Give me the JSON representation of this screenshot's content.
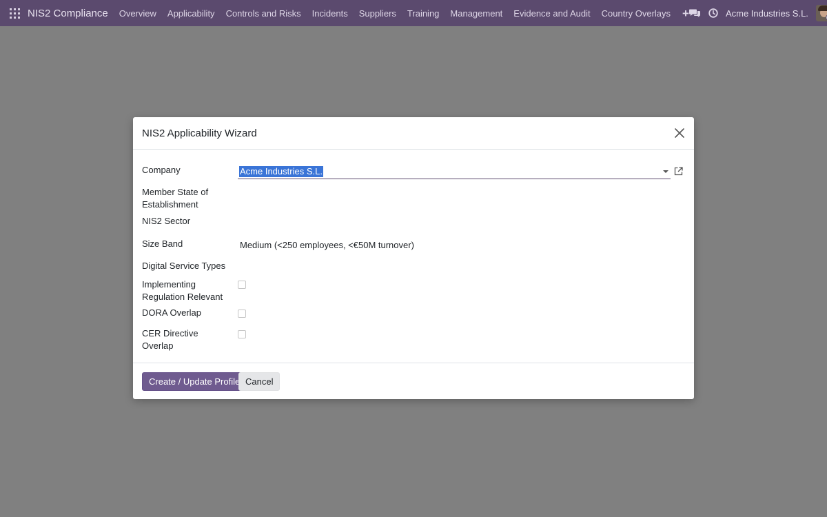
{
  "navbar": {
    "brand": "NIS2 Compliance",
    "menu": [
      "Overview",
      "Applicability",
      "Controls and Risks",
      "Incidents",
      "Suppliers",
      "Training",
      "Management",
      "Evidence and Audit",
      "Country Overlays"
    ],
    "plus_icon": "+",
    "icons": [
      "apps-grid-icon",
      "chat-icon",
      "clock-icon"
    ],
    "company": "Acme Industries S.L.",
    "colors": {
      "navbar_bg": "#5b4a6e",
      "primary": "#6f5b8f",
      "backdrop": "#808080"
    }
  },
  "dialog": {
    "title": "NIS2 Applicability Wizard",
    "fields": {
      "company": {
        "label": "Company",
        "value": "Acme Industries S.L."
      },
      "member_state": {
        "label": "Member State of Establishment"
      },
      "sector": {
        "label": "NIS2 Sector"
      },
      "size_band": {
        "label": "Size Band",
        "value": "Medium (<250 employees, <€50M turnover)"
      },
      "digital_service_types": {
        "label": "Digital Service Types"
      },
      "implementing_regulation": {
        "label": "Implementing Regulation Relevant",
        "checked": false
      },
      "dora_overlap": {
        "label": "DORA Overlap",
        "checked": false
      },
      "cer_overlap": {
        "label": "CER Directive Overlap",
        "checked": false
      }
    },
    "buttons": {
      "primary": "Create / Update Profile",
      "cancel": "Cancel"
    }
  }
}
